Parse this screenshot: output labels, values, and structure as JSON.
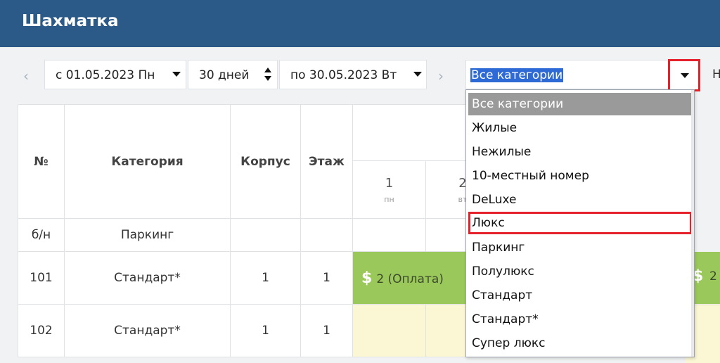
{
  "header": {
    "title": "Шахматка"
  },
  "toolbar": {
    "prev_arrow": "‹",
    "next_arrow": "›",
    "start_date": "с 01.05.2023 Пн",
    "duration": "30 дней",
    "end_date": "по 30.05.2023 Вт",
    "category_selected": "Все категории",
    "cut_label": "Н"
  },
  "table": {
    "headers": {
      "num": "№",
      "category": "Категория",
      "building": "Корпус",
      "floor": "Этаж"
    },
    "days": [
      {
        "day": "1",
        "dow": "пн"
      },
      {
        "day": "2",
        "dow": "вт"
      }
    ],
    "rows": [
      {
        "num": "б/н",
        "category": "Паркинг",
        "building": "",
        "floor": ""
      },
      {
        "num": "101",
        "category": "Стандарт*",
        "building": "1",
        "floor": "1"
      },
      {
        "num": "102",
        "category": "Стандарт*",
        "building": "1",
        "floor": "1"
      }
    ],
    "booking": {
      "dollar": "$",
      "text": "2 (Оплата)",
      "right_num": "2"
    }
  },
  "dropdown": {
    "options": [
      "Все категории",
      "Жилые",
      "Нежилые",
      "10-местный номер",
      "DeLuxe",
      "Люкс",
      "Паркинг",
      "Полулюкс",
      "Стандарт",
      "Стандарт*",
      "Супер люкс"
    ],
    "selected_index": 0,
    "highlighted_index": 5
  },
  "colors": {
    "header_bg": "#2c5a88",
    "booking_paid": "#9bc85a",
    "empty_cell": "#fbf6d3",
    "highlight_border": "#e5222b",
    "selection_bg": "#2d6ad6"
  }
}
